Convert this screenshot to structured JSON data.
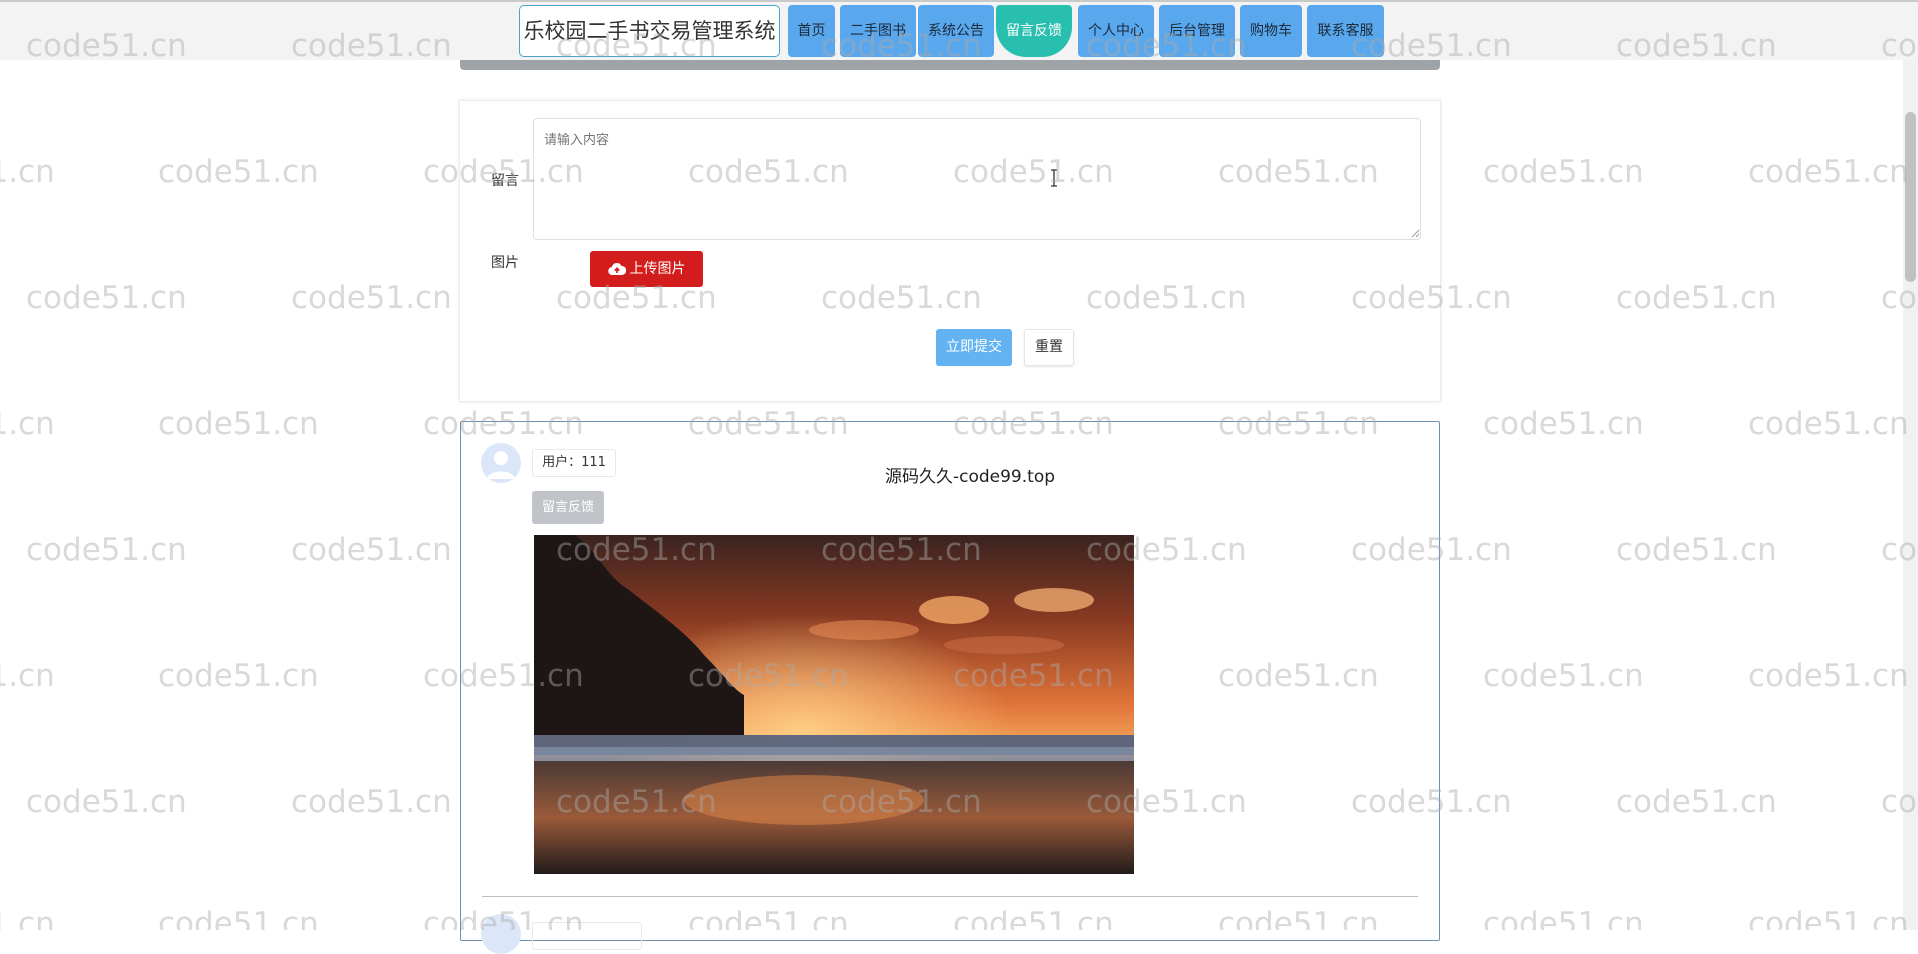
{
  "header": {
    "site_title": "乐校园二手书交易管理系统",
    "nav": [
      {
        "label": "首页",
        "active": false
      },
      {
        "label": "二手图书",
        "active": false
      },
      {
        "label": "系统公告",
        "active": false
      },
      {
        "label": "留言反馈",
        "active": true
      },
      {
        "label": "个人中心",
        "active": false
      },
      {
        "label": "后台管理",
        "active": false
      },
      {
        "label": "购物车",
        "active": false
      },
      {
        "label": "联系客服",
        "active": false
      }
    ]
  },
  "form": {
    "message_label": "留言",
    "message_placeholder": "请输入内容",
    "image_label": "图片",
    "upload_label": "上传图片",
    "submit_label": "立即提交",
    "reset_label": "重置"
  },
  "messages": [
    {
      "user": "用户：111",
      "title": "源码久久-code99.top",
      "feedback_label": "留言反馈",
      "image": "sunset-beach-photo"
    }
  ],
  "watermark": "code51.cn",
  "colors": {
    "nav_button": "#59a7ec",
    "nav_active": "#29bfae",
    "upload_button": "#d31c1c",
    "submit_button": "#63b3f2"
  }
}
